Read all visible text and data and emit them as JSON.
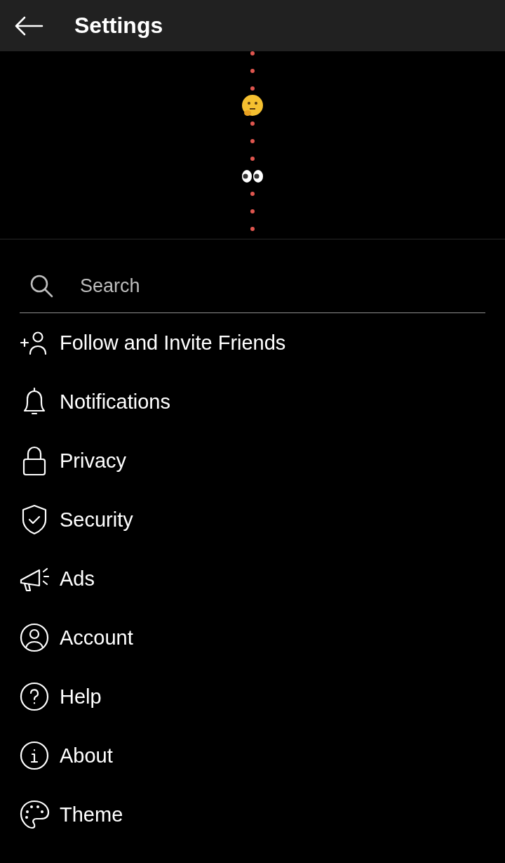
{
  "header": {
    "title": "Settings"
  },
  "search": {
    "placeholder": "Search"
  },
  "items": [
    {
      "label": "Follow and Invite Friends"
    },
    {
      "label": "Notifications"
    },
    {
      "label": "Privacy"
    },
    {
      "label": "Security"
    },
    {
      "label": "Ads"
    },
    {
      "label": "Account"
    },
    {
      "label": "Help"
    },
    {
      "label": "About"
    },
    {
      "label": "Theme"
    }
  ]
}
